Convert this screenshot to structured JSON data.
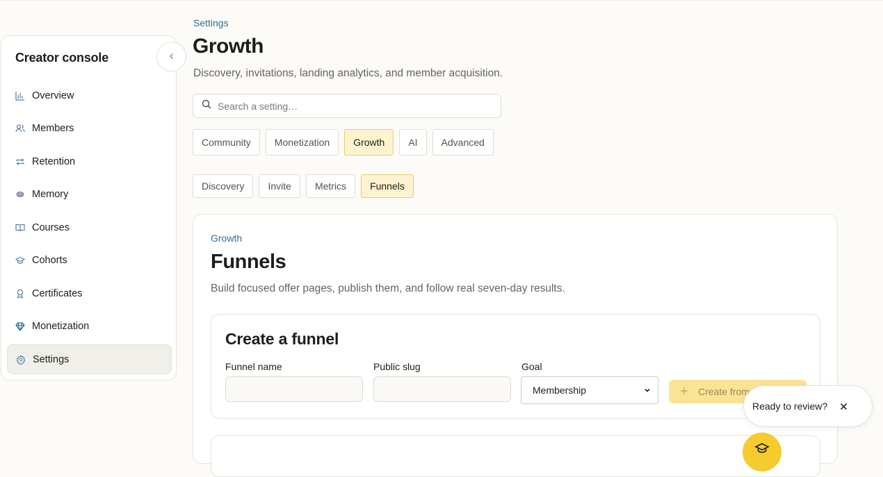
{
  "sidebar": {
    "title": "Creator console",
    "items": [
      {
        "label": "Overview"
      },
      {
        "label": "Members"
      },
      {
        "label": "Retention"
      },
      {
        "label": "Memory"
      },
      {
        "label": "Courses"
      },
      {
        "label": "Cohorts"
      },
      {
        "label": "Certificates"
      },
      {
        "label": "Monetization"
      },
      {
        "label": "Settings"
      }
    ],
    "active": "Settings"
  },
  "header": {
    "breadcrumb": "Settings",
    "title": "Growth",
    "subtitle": "Discovery, invitations, landing analytics, and member acquisition."
  },
  "search": {
    "placeholder": "Search a setting…",
    "value": ""
  },
  "tabs": {
    "primary": [
      {
        "label": "Community"
      },
      {
        "label": "Monetization"
      },
      {
        "label": "Growth"
      },
      {
        "label": "AI"
      },
      {
        "label": "Advanced"
      }
    ],
    "primary_active": "Growth",
    "secondary": [
      {
        "label": "Discovery"
      },
      {
        "label": "Invite"
      },
      {
        "label": "Metrics"
      },
      {
        "label": "Funnels"
      }
    ],
    "secondary_active": "Funnels"
  },
  "panel": {
    "breadcrumb": "Growth",
    "title": "Funnels",
    "subtitle": "Build focused offer pages, publish them, and follow real seven-day results."
  },
  "create_funnel": {
    "title": "Create a funnel",
    "name_label": "Funnel name",
    "name_value": "",
    "slug_label": "Public slug",
    "slug_value": "",
    "goal_label": "Goal",
    "goal_value": "Membership",
    "create_label": "Create from"
  },
  "toast": {
    "text": "Ready to review?"
  },
  "colors": {
    "accent": "#f5cb2d",
    "link": "#2f6f96",
    "active_tab_bg": "#fdf3cf"
  }
}
